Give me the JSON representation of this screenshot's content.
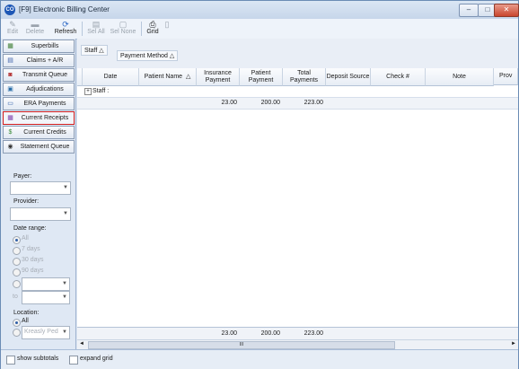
{
  "window": {
    "title": "[F9] Electronic Billing Center",
    "icon_text": "CO",
    "min": "–",
    "max": "□",
    "close": "✕"
  },
  "toolbar": {
    "edit": "Edit",
    "delete": "Delete",
    "refresh": "Refresh",
    "sel_all": "Sel All",
    "sel_none": "Sel None",
    "grid": "Grid"
  },
  "sidebar": {
    "nav": [
      "Superbills",
      "Claims + A/R",
      "Transmit Queue",
      "Adjudications",
      "ERA Payments",
      "Current Receipts",
      "Current Credits",
      "Statement Queue"
    ],
    "payer_label": "Payer:",
    "provider_label": "Provider:",
    "date_range_label": "Date range:",
    "date_options": [
      "All",
      "7 days",
      "30 days",
      "90 days"
    ],
    "to_label": "to",
    "location_label": "Location:",
    "location_all": "All",
    "location_value": "Kreasly Ped"
  },
  "groupbar": {
    "group1": "Staff",
    "group2": "Payment Method"
  },
  "grid": {
    "columns": [
      "Date",
      "Patient Name",
      "Insurance Payment",
      "Patient Payment",
      "Total Payments",
      "Deposit Source",
      "Check #",
      "Note",
      "Prov"
    ],
    "group_row": "Staff :",
    "summary": {
      "insurance": "23.00",
      "patient": "200.00",
      "total": "223.00"
    },
    "footer": {
      "insurance": "23.00",
      "patient": "200.00",
      "total": "223.00"
    },
    "scroll_mid": "III"
  },
  "status": {
    "show_subtotals": "show subtotals",
    "expand_grid": "expand grid"
  }
}
